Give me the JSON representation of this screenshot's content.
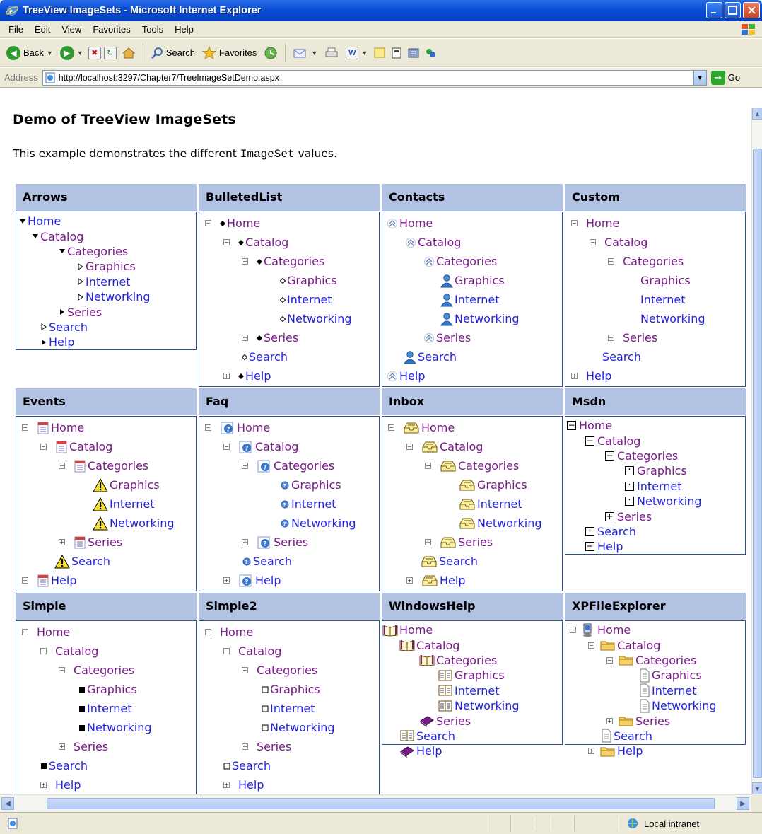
{
  "window": {
    "title": "TreeView ImageSets - Microsoft Internet Explorer"
  },
  "menu": [
    "File",
    "Edit",
    "View",
    "Favorites",
    "Tools",
    "Help"
  ],
  "toolbar": {
    "back": "Back",
    "search": "Search",
    "favorites": "Favorites"
  },
  "address": {
    "label": "Address",
    "url": "http://localhost:3297/Chapter7/TreeImageSetDemo.aspx",
    "go": "Go"
  },
  "page": {
    "title": "Demo of TreeView ImageSets",
    "desc_pre": "This example demonstrates the different ",
    "desc_code": "ImageSet",
    "desc_post": " values."
  },
  "panels": [
    {
      "name": "Arrows"
    },
    {
      "name": "BulletedList"
    },
    {
      "name": "Contacts"
    },
    {
      "name": "Custom"
    },
    {
      "name": "Events"
    },
    {
      "name": "Faq"
    },
    {
      "name": "Inbox"
    },
    {
      "name": "Msdn"
    },
    {
      "name": "Simple"
    },
    {
      "name": "Simple2"
    },
    {
      "name": "WindowsHelp"
    },
    {
      "name": "XPFileExplorer"
    }
  ],
  "tree_labels": {
    "home": "Home",
    "catalog": "Catalog",
    "categories": "Categories",
    "graphics": "Graphics",
    "internet": "Internet",
    "networking": "Networking",
    "series": "Series",
    "search": "Search",
    "help": "Help"
  },
  "status": {
    "zone": "Local intranet"
  },
  "colors": {
    "panel_header": "#b1c2e2",
    "link": "#2424e0",
    "visited_link": "#7a1b8a",
    "panel_border": "#2f4f8f"
  }
}
